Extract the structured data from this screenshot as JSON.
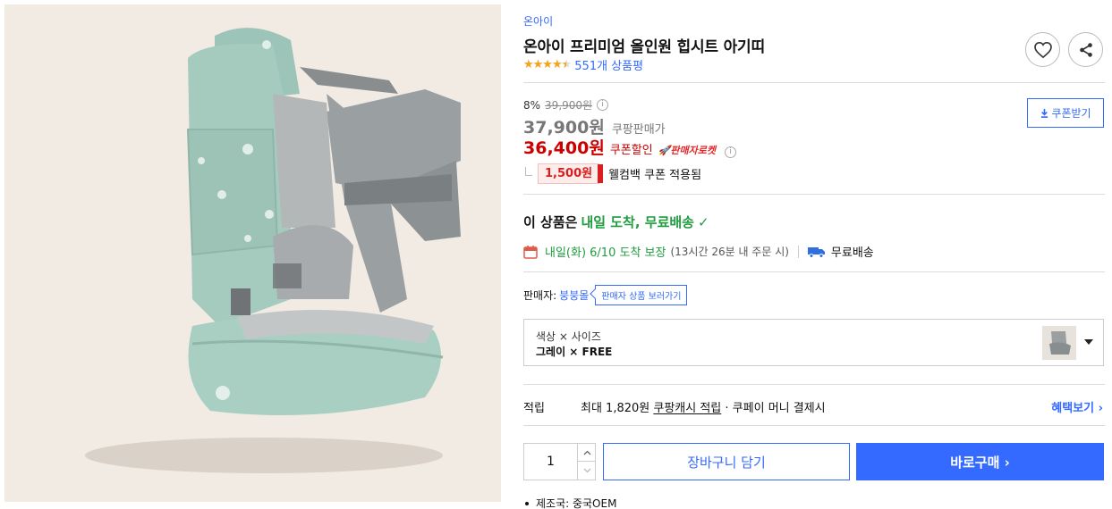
{
  "product": {
    "brand": "온아이",
    "title": "온아이 프리미엄 올인원 힙시트 아기띠",
    "rating_fraction": 0.9,
    "review_count": "551개 상품평"
  },
  "icons": {
    "heart": "heart-icon",
    "share": "share-icon",
    "info": "info-icon",
    "download": "download-icon",
    "calendar": "calendar-icon",
    "truck": "truck-icon"
  },
  "pricing": {
    "discount_rate": "8%",
    "original_price": "39,900원",
    "sale_price": "37,900원",
    "sale_label": "쿠팡판매가",
    "coupon_price": "36,400원",
    "coupon_label": "쿠폰할인",
    "rocket_badge": "🚀판매자로켓",
    "welcome_coupon_amount": "1,500원",
    "welcome_coupon_text": "웰컴백 쿠폰 적용됨",
    "coupon_button": "쿠폰받기"
  },
  "delivery": {
    "headline_prefix": "이 상품은",
    "headline_green": "내일 도착, 무료배송",
    "check": "✓",
    "arrival": "내일(화) 6/10 도착 보장",
    "order_window": "(13시간 26분 내 주문 시)",
    "free_shipping": "무료배송"
  },
  "seller": {
    "label": "판매자:",
    "name": "붕붕몰",
    "button": "판매자 상품 보러가기"
  },
  "option": {
    "label": "색상 × 사이즈",
    "value": "그레이 × FREE"
  },
  "points": {
    "key": "적립",
    "prefix": "최대 1,820원",
    "cash": "쿠팡캐시 적립",
    "suffix": "· 쿠페이 머니 결제시",
    "more": "혜택보기 ›"
  },
  "purchase": {
    "quantity": "1",
    "cart": "장바구니 담기",
    "buy": "바로구매 ›"
  },
  "details": {
    "manufacturer": "제조국: 중국OEM"
  },
  "colors": {
    "accent": "#346aff",
    "price_red": "#cc0000",
    "delivery_green": "#1f9d3f",
    "star": "#f6a31a",
    "carrier_mint": "#9cc4b8"
  }
}
